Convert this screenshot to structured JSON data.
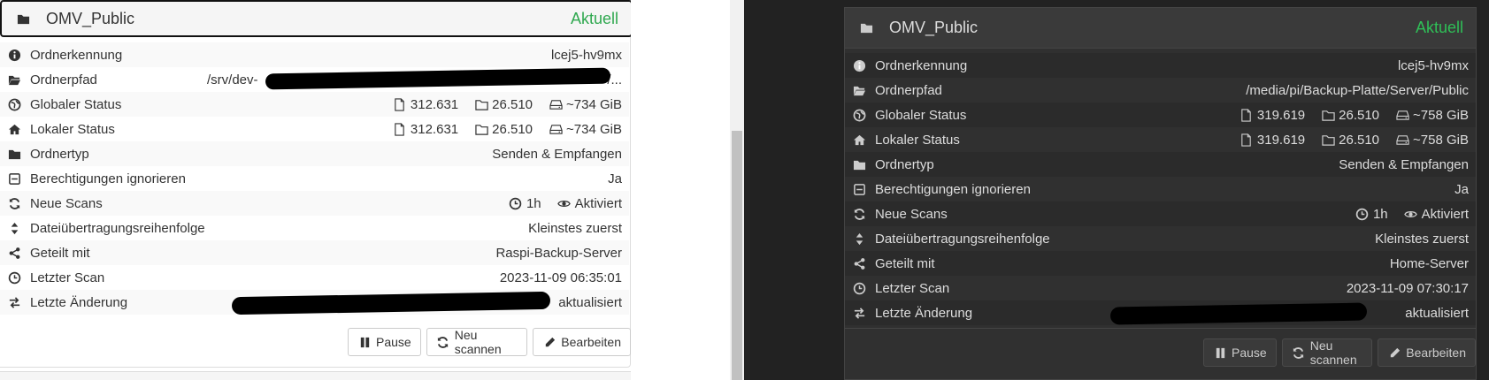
{
  "left": {
    "title": "OMV_Public",
    "status": "Aktuell",
    "rows": [
      {
        "icon": "info-icon",
        "label": "Ordnerkennung",
        "value": "lcej5-hv9mx"
      },
      {
        "icon": "folder-open-icon",
        "label": "Ordnerpfad",
        "value": "/srv/dev-",
        "value_tail": "/..."
      },
      {
        "icon": "globe-icon",
        "label": "Globaler Status",
        "files": "312.631",
        "folders": "26.510",
        "size": "~734 GiB"
      },
      {
        "icon": "home-icon",
        "label": "Lokaler Status",
        "files": "312.631",
        "folders": "26.510",
        "size": "~734 GiB"
      },
      {
        "icon": "folder-icon",
        "label": "Ordnertyp",
        "value": "Senden & Empfangen"
      },
      {
        "icon": "minus-square-icon",
        "label": "Berechtigungen ignorieren",
        "value": "Ja"
      },
      {
        "icon": "refresh-icon",
        "label": "Neue Scans",
        "interval": "1h",
        "watch": "Aktiviert"
      },
      {
        "icon": "sort-icon",
        "label": "Dateiübertragungsreihenfolge",
        "value": "Kleinstes zuerst"
      },
      {
        "icon": "share-icon",
        "label": "Geteilt mit",
        "value": "Raspi-Backup-Server"
      },
      {
        "icon": "clock-icon",
        "label": "Letzter Scan",
        "value": "2023-11-09 06:35:01"
      },
      {
        "icon": "exchange-icon",
        "label": "Letzte Änderung",
        "value": "aktualisiert"
      }
    ],
    "buttons": {
      "pause": "Pause",
      "rescan": "Neu scannen",
      "edit": "Bearbeiten"
    }
  },
  "right": {
    "title": "OMV_Public",
    "status": "Aktuell",
    "rows": [
      {
        "icon": "info-icon",
        "label": "Ordnerkennung",
        "value": "lcej5-hv9mx"
      },
      {
        "icon": "folder-open-icon",
        "label": "Ordnerpfad",
        "value": "/media/pi/Backup-Platte/Server/Public"
      },
      {
        "icon": "globe-icon",
        "label": "Globaler Status",
        "files": "319.619",
        "folders": "26.510",
        "size": "~758 GiB"
      },
      {
        "icon": "home-icon",
        "label": "Lokaler Status",
        "files": "319.619",
        "folders": "26.510",
        "size": "~758 GiB"
      },
      {
        "icon": "folder-icon",
        "label": "Ordnertyp",
        "value": "Senden & Empfangen"
      },
      {
        "icon": "minus-square-icon",
        "label": "Berechtigungen ignorieren",
        "value": "Ja"
      },
      {
        "icon": "refresh-icon",
        "label": "Neue Scans",
        "interval": "1h",
        "watch": "Aktiviert"
      },
      {
        "icon": "sort-icon",
        "label": "Dateiübertragungsreihenfolge",
        "value": "Kleinstes zuerst"
      },
      {
        "icon": "share-icon",
        "label": "Geteilt mit",
        "value": "Home-Server"
      },
      {
        "icon": "clock-icon",
        "label": "Letzter Scan",
        "value": "2023-11-09 07:30:17"
      },
      {
        "icon": "exchange-icon",
        "label": "Letzte Änderung",
        "value": "aktualisiert"
      }
    ],
    "buttons": {
      "pause": "Pause",
      "rescan": "Neu scannen",
      "edit": "Bearbeiten"
    }
  }
}
